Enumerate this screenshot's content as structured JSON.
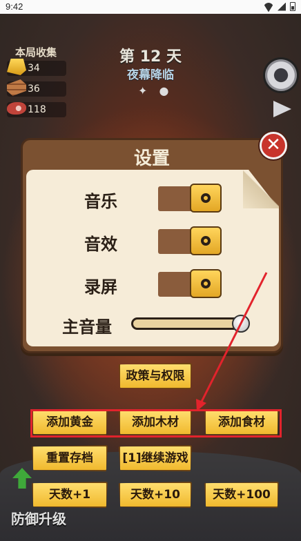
{
  "status_bar": {
    "time": "9:42"
  },
  "hud": {
    "collect_title": "本局收集",
    "resources": [
      {
        "name": "gold",
        "icon": "gold-bar-icon",
        "value": "34"
      },
      {
        "name": "wood",
        "icon": "wood-plank-icon",
        "value": "36"
      },
      {
        "name": "meat",
        "icon": "meat-icon",
        "value": "118"
      }
    ],
    "day": "第 12 天",
    "phase": "夜幕降临"
  },
  "settings": {
    "title": "设置",
    "rows": [
      {
        "label": "音乐",
        "type": "toggle",
        "on": true
      },
      {
        "label": "音效",
        "type": "toggle",
        "on": true
      },
      {
        "label": "录屏",
        "type": "toggle",
        "on": true
      },
      {
        "label": "主音量",
        "type": "slider",
        "value": 0.95
      }
    ]
  },
  "buttons": {
    "policy": "政策与权限",
    "add_gold": "添加黄金",
    "add_wood": "添加木材",
    "add_food": "添加食材",
    "reset_save": "重置存档",
    "continue_game": "[1]继续游戏",
    "days_plus_1": "天数+1",
    "days_plus_10": "天数+10",
    "days_plus_100": "天数+100"
  },
  "bottom": {
    "defense_upgrade": "防御升级"
  },
  "colors": {
    "panel": "#7b5131",
    "paper": "#f6ecd8",
    "button": "#f0b92e",
    "highlight": "#e2232c"
  }
}
